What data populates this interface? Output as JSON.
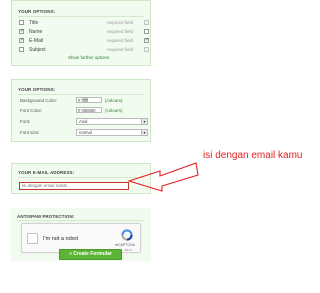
{
  "options_panel": {
    "title": "YOUR OPTIONS:",
    "rows": [
      {
        "label": "Title",
        "checked": false,
        "required_label": "required field",
        "required_checked": false
      },
      {
        "label": "Name",
        "checked": true,
        "required_label": "required field",
        "required_checked": false
      },
      {
        "label": "E-Mail",
        "checked": true,
        "required_label": "required field",
        "required_checked": true
      },
      {
        "label": "Subject",
        "checked": false,
        "required_label": "required field",
        "required_checked": false
      }
    ],
    "show_more": "Show further options"
  },
  "style_panel": {
    "title": "YOUR OPTIONS:",
    "background_color_label": "Background Color:",
    "background_color_value": "# ffffff",
    "background_color_unit": "(colours)",
    "font_color_label": "Font Color:",
    "font_color_value": "# 000000",
    "font_color_unit": "(colours)",
    "font_label": "Font:",
    "font_value": "Arial",
    "font_size_label": "Font size:",
    "font_size_value": "normal"
  },
  "email_panel": {
    "title": "YOUR E-MAIL ADDRESS:",
    "value": "isi dengan email sobat"
  },
  "antispam_panel": {
    "title": "ANTISPAM PROTECTION:",
    "captcha_label": "I'm not a robot",
    "captcha_brand": "reCAPTCHA",
    "captcha_terms": "Privacy - Terms"
  },
  "create_button": {
    "label": "» Create Formular"
  },
  "annotation": {
    "text": "isi dengan email kamu",
    "color": "#e02020"
  },
  "colors": {
    "panel_bg": "#f2fbf0",
    "panel_border": "#cfe6c7",
    "accent_green": "#5cb435",
    "link_green": "#2e7d2e",
    "error_red": "#c0392b"
  }
}
